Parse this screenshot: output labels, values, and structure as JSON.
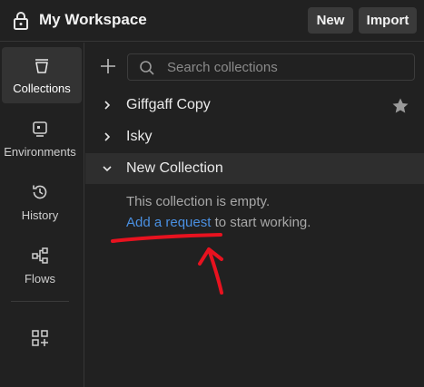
{
  "header": {
    "workspace_title": "My Workspace",
    "new_label": "New",
    "import_label": "Import"
  },
  "sidebar": {
    "items": [
      {
        "label": "Collections",
        "icon": "collections-icon",
        "active": true
      },
      {
        "label": "Environments",
        "icon": "environments-icon",
        "active": false
      },
      {
        "label": "History",
        "icon": "history-icon",
        "active": false
      },
      {
        "label": "Flows",
        "icon": "flows-icon",
        "active": false
      }
    ],
    "configure_icon": "add-widget-icon"
  },
  "main": {
    "search_placeholder": "Search collections",
    "collections": [
      {
        "name": "Giffgaff Copy",
        "expanded": false,
        "starred": true
      },
      {
        "name": "Isky",
        "expanded": false,
        "starred": false
      },
      {
        "name": "New Collection",
        "expanded": true,
        "starred": false
      }
    ],
    "empty_message": "This collection is empty.",
    "add_request_link": "Add a request",
    "add_request_suffix": " to start working."
  },
  "colors": {
    "background": "#212121",
    "link": "#4a90e2",
    "annotation": "#e8121f"
  }
}
